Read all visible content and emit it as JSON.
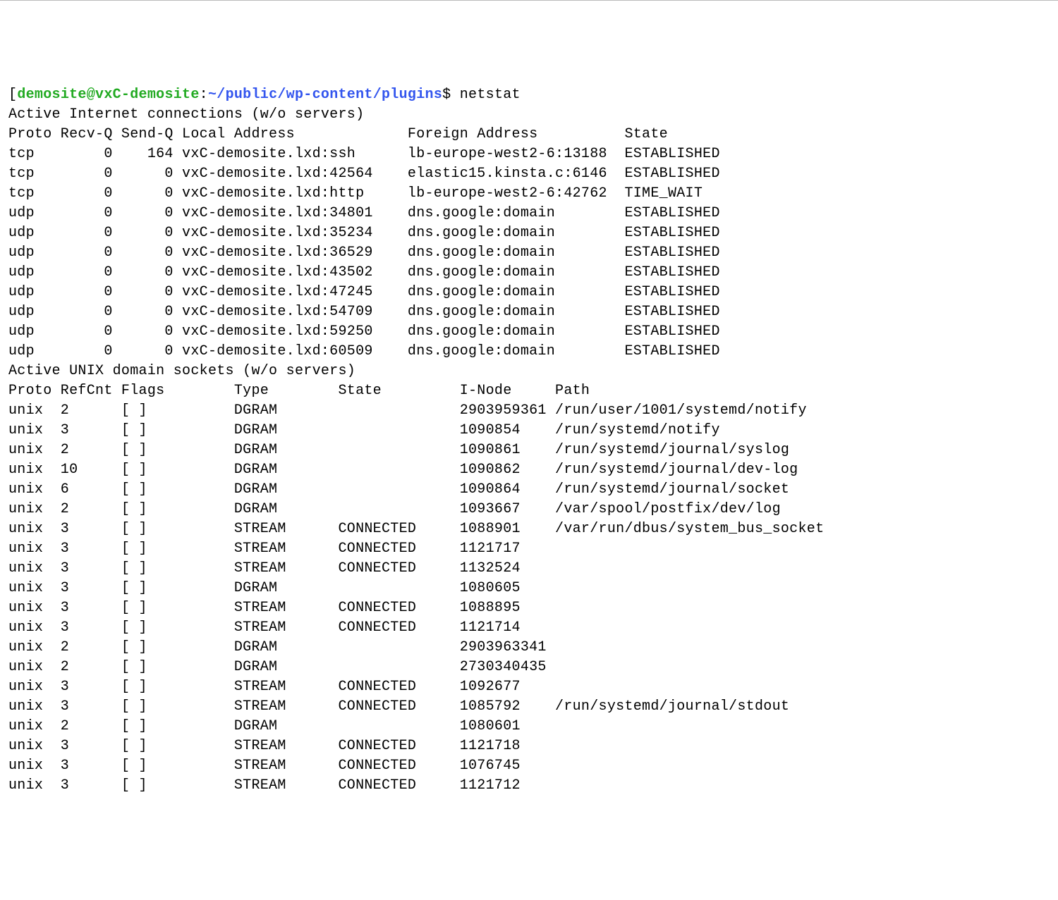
{
  "prompt": {
    "bracket_open": "[",
    "user_host": "demosite@vxC-demosite",
    "colon": ":",
    "path": "~/public/wp-content/plugins",
    "dollar": "$",
    "command": "netstat"
  },
  "section1_title": "Active Internet connections (w/o servers)",
  "inet_headers": {
    "proto": "Proto",
    "recvq": "Recv-Q",
    "sendq": "Send-Q",
    "local": "Local Address",
    "foreign": "Foreign Address",
    "state": "State"
  },
  "inet_rows": [
    {
      "proto": "tcp",
      "recvq": "0",
      "sendq": "164",
      "local": "vxC-demosite.lxd:ssh",
      "foreign": "lb-europe-west2-6:13188",
      "state": "ESTABLISHED"
    },
    {
      "proto": "tcp",
      "recvq": "0",
      "sendq": "0",
      "local": "vxC-demosite.lxd:42564",
      "foreign": "elastic15.kinsta.c:6146",
      "state": "ESTABLISHED"
    },
    {
      "proto": "tcp",
      "recvq": "0",
      "sendq": "0",
      "local": "vxC-demosite.lxd:http",
      "foreign": "lb-europe-west2-6:42762",
      "state": "TIME_WAIT"
    },
    {
      "proto": "udp",
      "recvq": "0",
      "sendq": "0",
      "local": "vxC-demosite.lxd:34801",
      "foreign": "dns.google:domain",
      "state": "ESTABLISHED"
    },
    {
      "proto": "udp",
      "recvq": "0",
      "sendq": "0",
      "local": "vxC-demosite.lxd:35234",
      "foreign": "dns.google:domain",
      "state": "ESTABLISHED"
    },
    {
      "proto": "udp",
      "recvq": "0",
      "sendq": "0",
      "local": "vxC-demosite.lxd:36529",
      "foreign": "dns.google:domain",
      "state": "ESTABLISHED"
    },
    {
      "proto": "udp",
      "recvq": "0",
      "sendq": "0",
      "local": "vxC-demosite.lxd:43502",
      "foreign": "dns.google:domain",
      "state": "ESTABLISHED"
    },
    {
      "proto": "udp",
      "recvq": "0",
      "sendq": "0",
      "local": "vxC-demosite.lxd:47245",
      "foreign": "dns.google:domain",
      "state": "ESTABLISHED"
    },
    {
      "proto": "udp",
      "recvq": "0",
      "sendq": "0",
      "local": "vxC-demosite.lxd:54709",
      "foreign": "dns.google:domain",
      "state": "ESTABLISHED"
    },
    {
      "proto": "udp",
      "recvq": "0",
      "sendq": "0",
      "local": "vxC-demosite.lxd:59250",
      "foreign": "dns.google:domain",
      "state": "ESTABLISHED"
    },
    {
      "proto": "udp",
      "recvq": "0",
      "sendq": "0",
      "local": "vxC-demosite.lxd:60509",
      "foreign": "dns.google:domain",
      "state": "ESTABLISHED"
    }
  ],
  "section2_title": "Active UNIX domain sockets (w/o servers)",
  "unix_headers": {
    "proto": "Proto",
    "refcnt": "RefCnt",
    "flags": "Flags",
    "type": "Type",
    "state": "State",
    "inode": "I-Node",
    "path": "Path"
  },
  "unix_rows": [
    {
      "proto": "unix",
      "refcnt": "2",
      "flags": "[ ]",
      "type": "DGRAM",
      "state": "",
      "inode": "2903959361",
      "path": "/run/user/1001/systemd/notify"
    },
    {
      "proto": "unix",
      "refcnt": "3",
      "flags": "[ ]",
      "type": "DGRAM",
      "state": "",
      "inode": "1090854",
      "path": "/run/systemd/notify"
    },
    {
      "proto": "unix",
      "refcnt": "2",
      "flags": "[ ]",
      "type": "DGRAM",
      "state": "",
      "inode": "1090861",
      "path": "/run/systemd/journal/syslog"
    },
    {
      "proto": "unix",
      "refcnt": "10",
      "flags": "[ ]",
      "type": "DGRAM",
      "state": "",
      "inode": "1090862",
      "path": "/run/systemd/journal/dev-log"
    },
    {
      "proto": "unix",
      "refcnt": "6",
      "flags": "[ ]",
      "type": "DGRAM",
      "state": "",
      "inode": "1090864",
      "path": "/run/systemd/journal/socket"
    },
    {
      "proto": "unix",
      "refcnt": "2",
      "flags": "[ ]",
      "type": "DGRAM",
      "state": "",
      "inode": "1093667",
      "path": "/var/spool/postfix/dev/log"
    },
    {
      "proto": "unix",
      "refcnt": "3",
      "flags": "[ ]",
      "type": "STREAM",
      "state": "CONNECTED",
      "inode": "1088901",
      "path": "/var/run/dbus/system_bus_socket"
    },
    {
      "proto": "unix",
      "refcnt": "3",
      "flags": "[ ]",
      "type": "STREAM",
      "state": "CONNECTED",
      "inode": "1121717",
      "path": ""
    },
    {
      "proto": "unix",
      "refcnt": "3",
      "flags": "[ ]",
      "type": "STREAM",
      "state": "CONNECTED",
      "inode": "1132524",
      "path": ""
    },
    {
      "proto": "unix",
      "refcnt": "3",
      "flags": "[ ]",
      "type": "DGRAM",
      "state": "",
      "inode": "1080605",
      "path": ""
    },
    {
      "proto": "unix",
      "refcnt": "3",
      "flags": "[ ]",
      "type": "STREAM",
      "state": "CONNECTED",
      "inode": "1088895",
      "path": ""
    },
    {
      "proto": "unix",
      "refcnt": "3",
      "flags": "[ ]",
      "type": "STREAM",
      "state": "CONNECTED",
      "inode": "1121714",
      "path": ""
    },
    {
      "proto": "unix",
      "refcnt": "2",
      "flags": "[ ]",
      "type": "DGRAM",
      "state": "",
      "inode": "2903963341",
      "path": ""
    },
    {
      "proto": "unix",
      "refcnt": "2",
      "flags": "[ ]",
      "type": "DGRAM",
      "state": "",
      "inode": "2730340435",
      "path": ""
    },
    {
      "proto": "unix",
      "refcnt": "3",
      "flags": "[ ]",
      "type": "STREAM",
      "state": "CONNECTED",
      "inode": "1092677",
      "path": ""
    },
    {
      "proto": "unix",
      "refcnt": "3",
      "flags": "[ ]",
      "type": "STREAM",
      "state": "CONNECTED",
      "inode": "1085792",
      "path": "/run/systemd/journal/stdout"
    },
    {
      "proto": "unix",
      "refcnt": "2",
      "flags": "[ ]",
      "type": "DGRAM",
      "state": "",
      "inode": "1080601",
      "path": ""
    },
    {
      "proto": "unix",
      "refcnt": "3",
      "flags": "[ ]",
      "type": "STREAM",
      "state": "CONNECTED",
      "inode": "1121718",
      "path": ""
    },
    {
      "proto": "unix",
      "refcnt": "3",
      "flags": "[ ]",
      "type": "STREAM",
      "state": "CONNECTED",
      "inode": "1076745",
      "path": ""
    },
    {
      "proto": "unix",
      "refcnt": "3",
      "flags": "[ ]",
      "type": "STREAM",
      "state": "CONNECTED",
      "inode": "1121712",
      "path": ""
    }
  ]
}
